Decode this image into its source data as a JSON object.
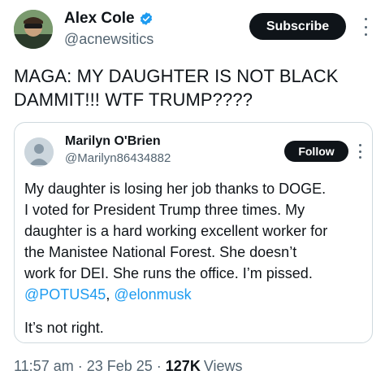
{
  "author": {
    "display_name": "Alex Cole",
    "handle": "@acnewsitics",
    "verified": true,
    "verified_color": "#1d9bf0"
  },
  "actions": {
    "subscribe_label": "Subscribe"
  },
  "tweet": {
    "text": "MAGA: MY DAUGHTER IS NOT BLACK DAMMIT!!! WTF TRUMP????"
  },
  "quote": {
    "display_name": "Marilyn O'Brien",
    "handle": "@Marilyn86434882",
    "follow_label": "Follow",
    "lines": [
      "My daughter is losing her job thanks to DOGE.",
      "I voted for President Trump three times.  My",
      "daughter is a hard working excellent worker for",
      "the Manistee National Forest.   She doesn’t",
      "work for DEI.  She runs the office.  I’m pissed."
    ],
    "mention_1": "@POTUS45",
    "mention_sep": ", ",
    "mention_2": "@elonmusk",
    "last_line": "It’s not right.",
    "mention_color": "#1d9bf0"
  },
  "meta": {
    "time": "11:57 am",
    "date": "23 Feb 25",
    "sep": "·",
    "views_count": "127K",
    "views_label": "Views"
  }
}
